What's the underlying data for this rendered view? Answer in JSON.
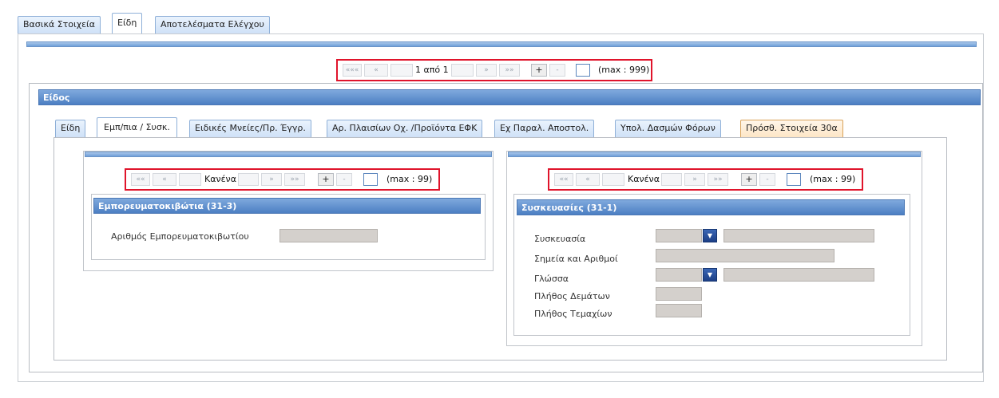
{
  "top_tabs": [
    "Βασικά Στοιχεία",
    "Είδη",
    "Αποτελέσματα Ελέγχου"
  ],
  "main_pager": {
    "first": "«««",
    "prev": "«",
    "position": "1 από 1",
    "next": "»",
    "last": "»»",
    "add": "+",
    "remove": "-",
    "max": "(max : 999)"
  },
  "section_header": "Είδος",
  "inner_tabs": [
    "Είδη",
    "Εμπ/πια / Συσκ.",
    "Ειδικές Μνείες/Πρ. Έγγρ.",
    "Αρ. Πλαισίων Οχ. /Προϊόντα ΕΦΚ",
    "Εχ Παραλ. Αποστολ.",
    "Υπολ. Δασμών Φόρων",
    "Πρόσθ. Στοιχεία 30α"
  ],
  "left": {
    "pager": {
      "first": "««",
      "prev": "«",
      "position": "Κανένα",
      "next": "»",
      "last": "»»",
      "add": "+",
      "remove": "-",
      "max": "(max : 99)"
    },
    "header": "Εμπορευματοκιβώτια (31-3)",
    "label_container": "Αριθμός Εμπορευματοκιβωτίου"
  },
  "right": {
    "pager": {
      "first": "««",
      "prev": "«",
      "position": "Κανένα",
      "next": "»",
      "last": "»»",
      "add": "+",
      "remove": "-",
      "max": "(max : 99)"
    },
    "header": "Συσκευασίες (31-1)",
    "label_package": "Συσκευασία",
    "label_marks": "Σημεία και Αριθμοί",
    "label_language": "Γλώσσα",
    "label_bundles": "Πλήθος Δεμάτων",
    "label_pieces": "Πλήθος Τεμαχίων"
  },
  "icons": {
    "dropdown": "chevron-down-icon"
  }
}
